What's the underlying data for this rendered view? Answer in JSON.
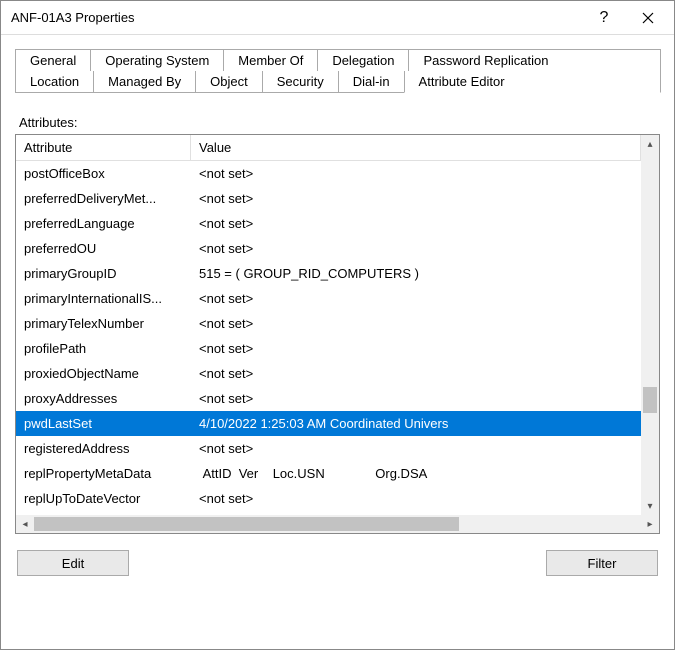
{
  "window": {
    "title": "ANF-01A3 Properties"
  },
  "tabs": {
    "row1": [
      {
        "label": "General"
      },
      {
        "label": "Operating System"
      },
      {
        "label": "Member Of"
      },
      {
        "label": "Delegation"
      },
      {
        "label": "Password Replication"
      }
    ],
    "row2": [
      {
        "label": "Location"
      },
      {
        "label": "Managed By"
      },
      {
        "label": "Object"
      },
      {
        "label": "Security"
      },
      {
        "label": "Dial-in"
      },
      {
        "label": "Attribute Editor",
        "active": true
      }
    ]
  },
  "section_label": "Attributes:",
  "columns": {
    "attr": "Attribute",
    "val": "Value"
  },
  "rows": [
    {
      "attr": "postOfficeBox",
      "val": "<not set>"
    },
    {
      "attr": "preferredDeliveryMet...",
      "val": "<not set>"
    },
    {
      "attr": "preferredLanguage",
      "val": "<not set>"
    },
    {
      "attr": "preferredOU",
      "val": "<not set>"
    },
    {
      "attr": "primaryGroupID",
      "val": "515 = ( GROUP_RID_COMPUTERS )"
    },
    {
      "attr": "primaryInternationalIS...",
      "val": "<not set>"
    },
    {
      "attr": "primaryTelexNumber",
      "val": "<not set>"
    },
    {
      "attr": "profilePath",
      "val": "<not set>"
    },
    {
      "attr": "proxiedObjectName",
      "val": "<not set>"
    },
    {
      "attr": "proxyAddresses",
      "val": "<not set>"
    },
    {
      "attr": "pwdLastSet",
      "val": "4/10/2022 1:25:03 AM Coordinated Univers",
      "selected": true
    },
    {
      "attr": "registeredAddress",
      "val": "<not set>"
    },
    {
      "attr": "replPropertyMetaData",
      "val": " AttID  Ver    Loc.USN              Org.DSA"
    },
    {
      "attr": "replUpToDateVector",
      "val": "<not set>"
    }
  ],
  "buttons": {
    "edit": "Edit",
    "filter": "Filter"
  }
}
